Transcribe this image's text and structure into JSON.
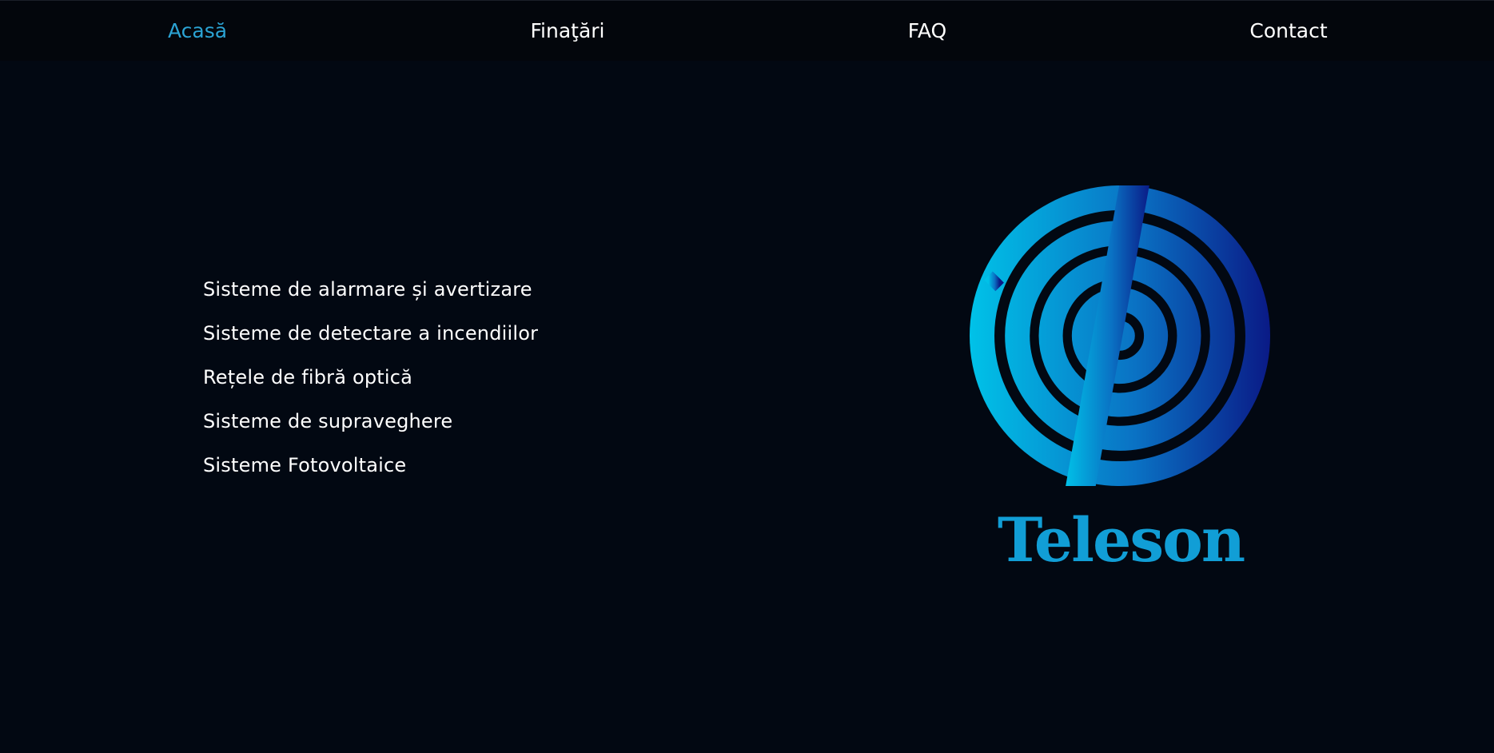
{
  "nav": {
    "items": [
      {
        "label": "Acasă",
        "active": true
      },
      {
        "label": "Finaţări",
        "active": false
      },
      {
        "label": "FAQ",
        "active": false
      },
      {
        "label": "Contact",
        "active": false
      }
    ]
  },
  "services": [
    "Sisteme de alarmare și avertizare",
    "Sisteme de detectare a incendiilor",
    "Rețele de fibră optică",
    "Sisteme de supraveghere",
    "Sisteme Fotovoltaice"
  ],
  "brand": {
    "name": "Teleson",
    "logo_icon": "teleson-logo-icon",
    "colors": {
      "accent": "#2ba3d4",
      "brand_text": "#119ed6",
      "gradient_light": "#00c2e8",
      "gradient_dark": "#0a1a86",
      "background": "#020812",
      "nav_background": "#03060c"
    }
  }
}
